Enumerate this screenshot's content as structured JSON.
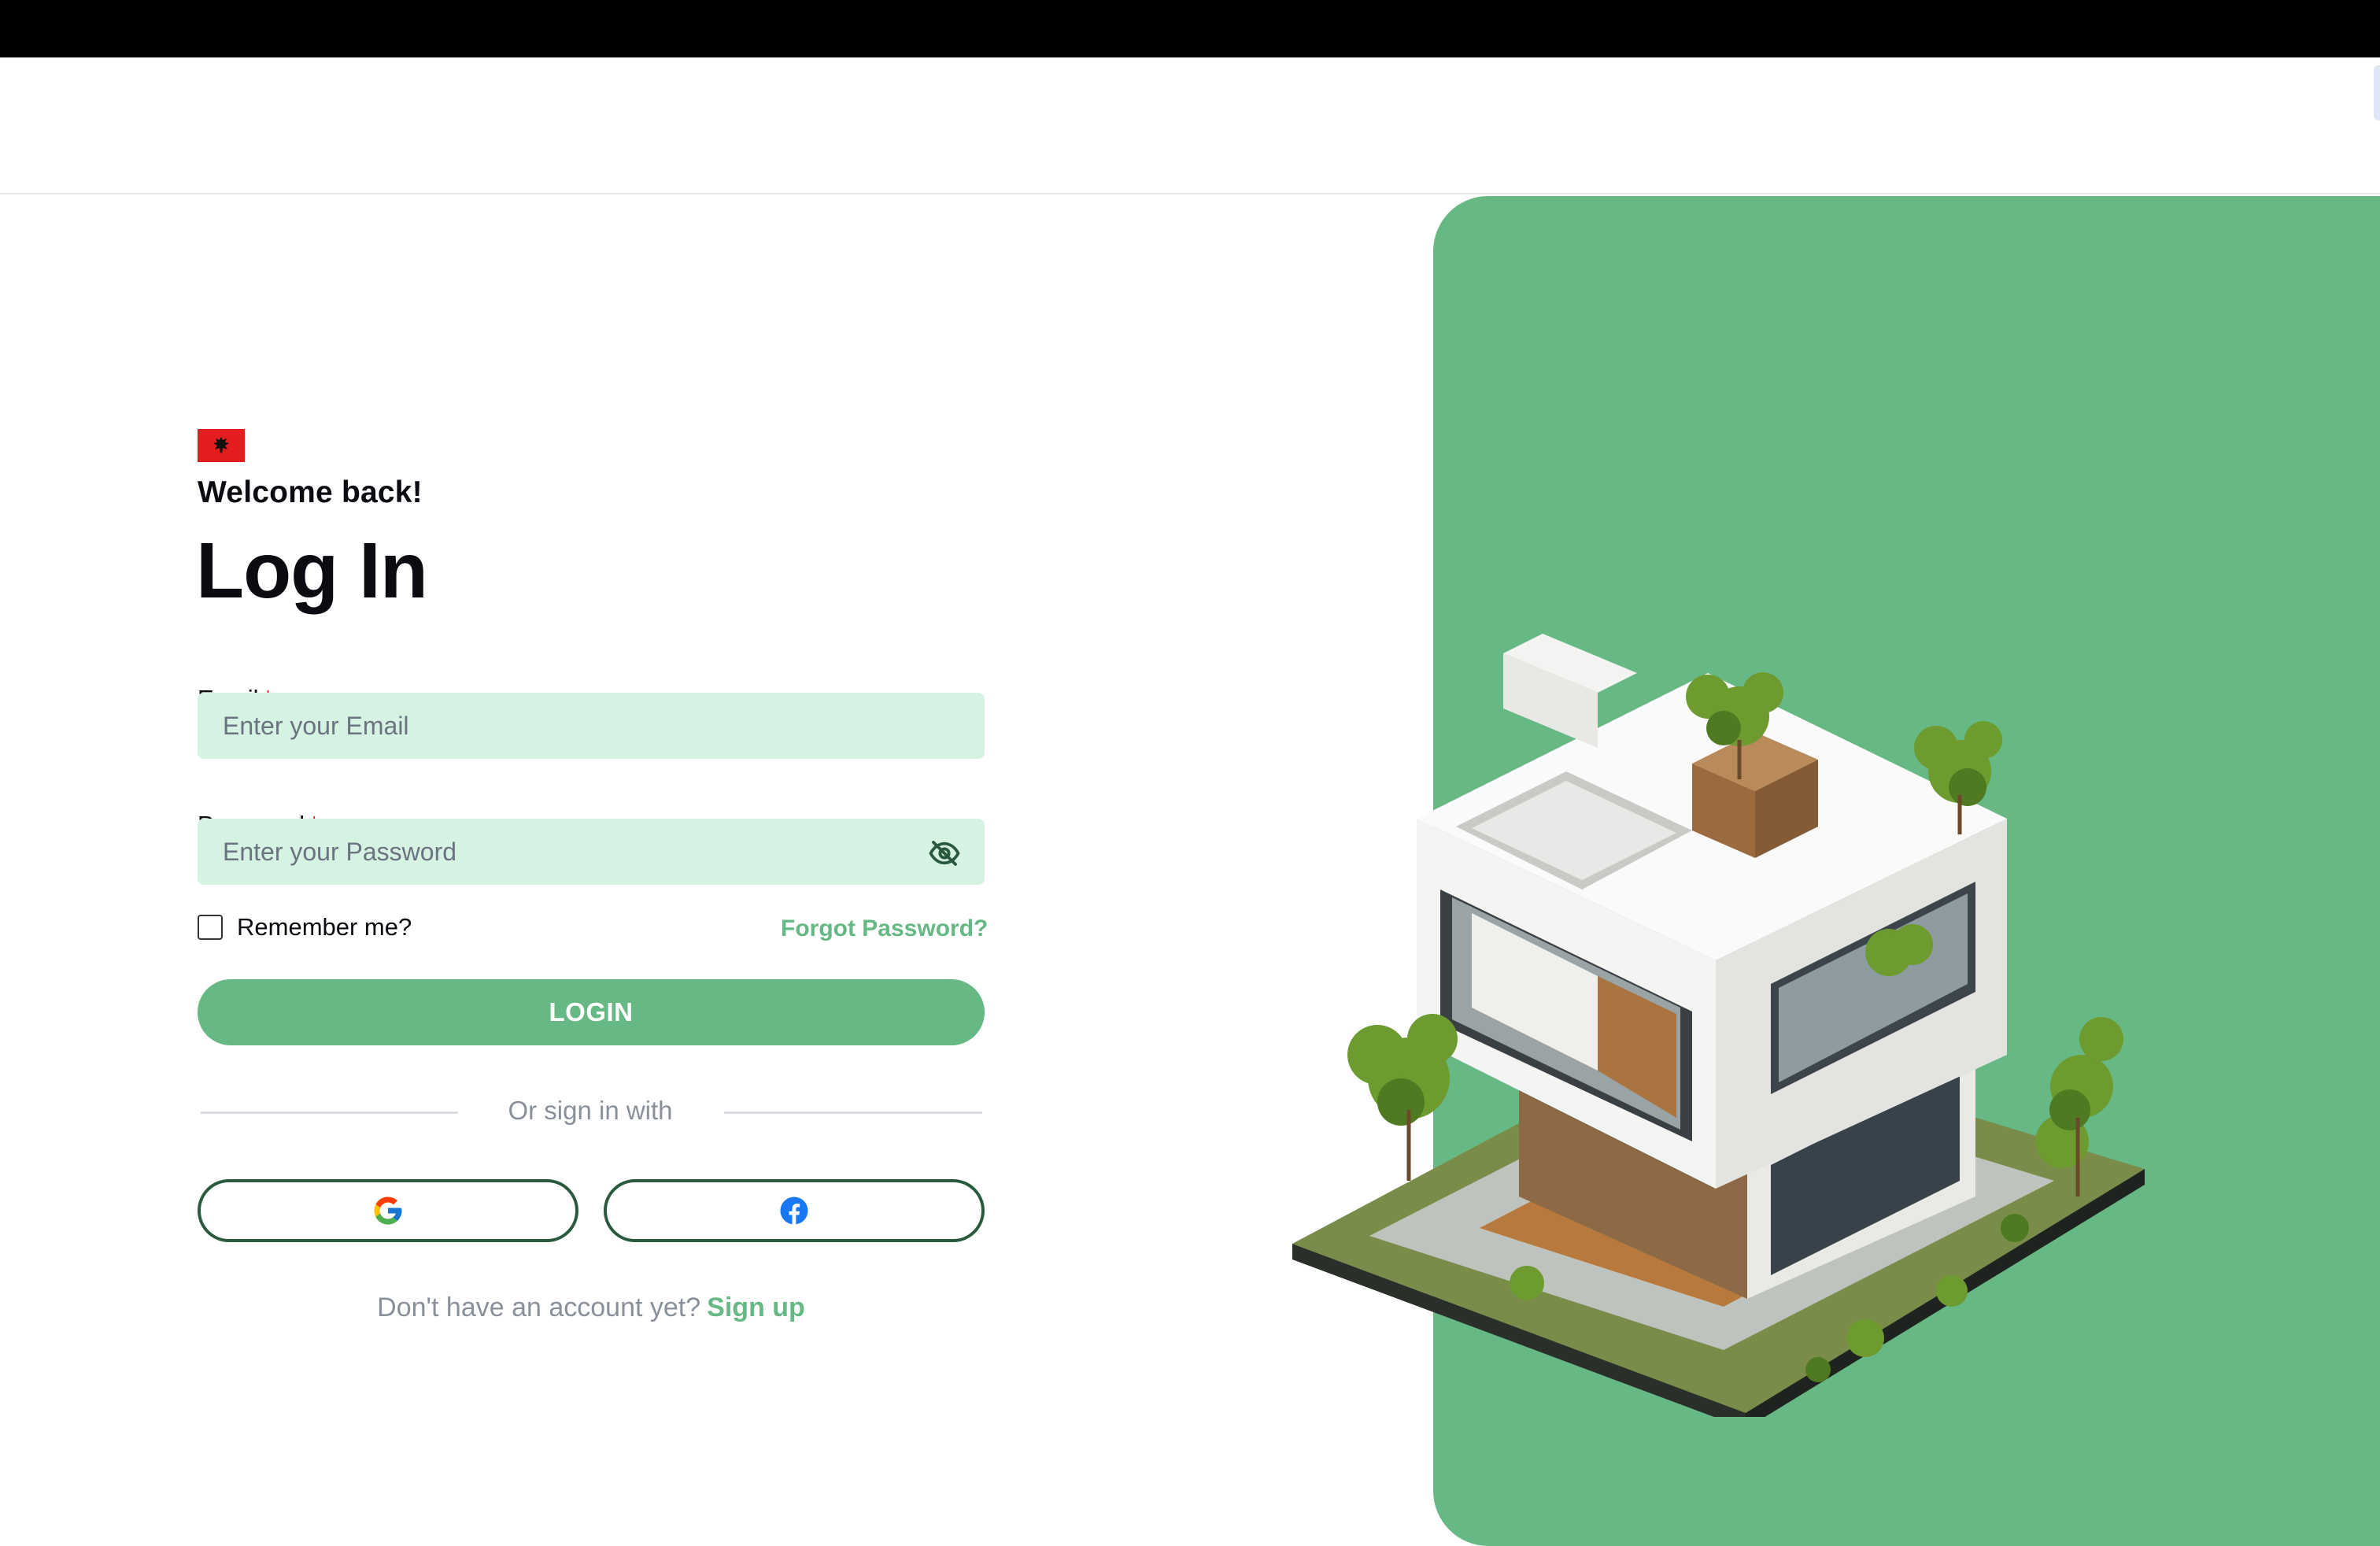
{
  "login": {
    "greeting": "Welcome back!",
    "title": "Log In",
    "email": {
      "label": "Email",
      "required_mark": "*",
      "placeholder": "Enter your Email",
      "value": ""
    },
    "password": {
      "label": "Password",
      "required_mark": "*",
      "placeholder": "Enter your Password",
      "value": "",
      "visibility_icon": "eye-slash-icon"
    },
    "remember_label": "Remember me?",
    "remember_checked": false,
    "forgot_label": "Forgot Password?",
    "login_label": "LOGIN",
    "divider_text": "Or sign in with",
    "social": [
      {
        "provider": "Google",
        "icon": "google-icon"
      },
      {
        "provider": "Facebook",
        "icon": "facebook-icon"
      }
    ],
    "signup_prompt": "Don't have an account yet?",
    "signup_label": "Sign up"
  },
  "language": {
    "flag_icon": "albania-flag-icon"
  },
  "colors": {
    "accent": "#66b985",
    "input_bg": "#d5f2e3",
    "social_border": "#2a5a3d",
    "required": "#e02424",
    "muted_text": "#8a909a",
    "heading": "#0b0b12"
  }
}
